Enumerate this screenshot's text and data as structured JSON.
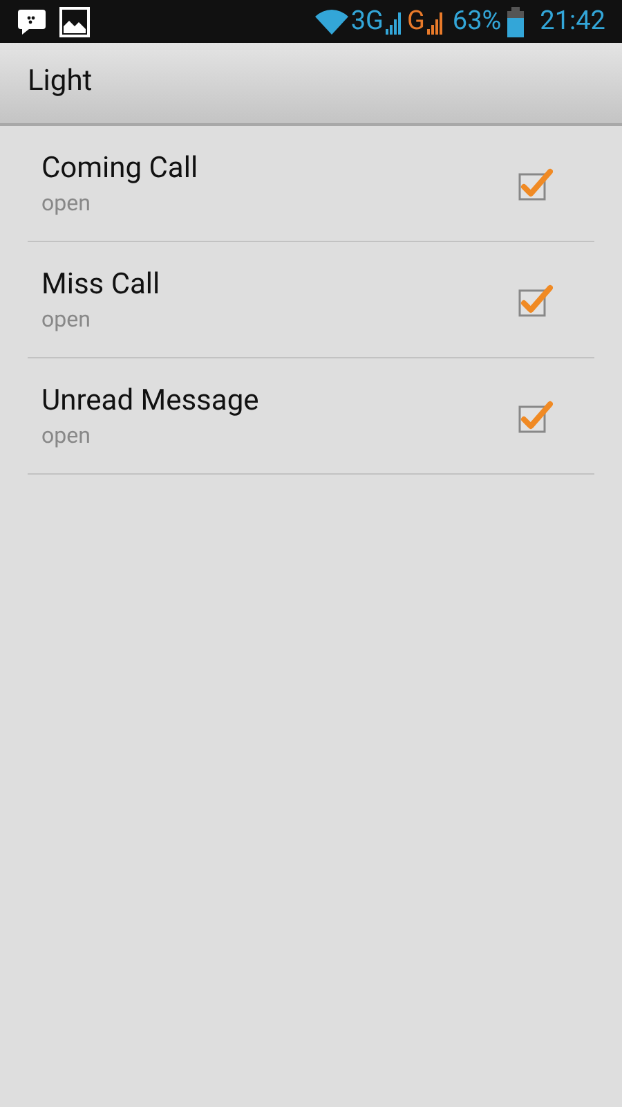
{
  "status_bar": {
    "network_1": "3G",
    "network_2": "G",
    "battery": "63%",
    "time": "21:42"
  },
  "title": "Light",
  "items": [
    {
      "title": "Coming Call",
      "summary": "open",
      "checked": true
    },
    {
      "title": "Miss Call",
      "summary": "open",
      "checked": true
    },
    {
      "title": "Unread Message",
      "summary": "open",
      "checked": true
    }
  ]
}
